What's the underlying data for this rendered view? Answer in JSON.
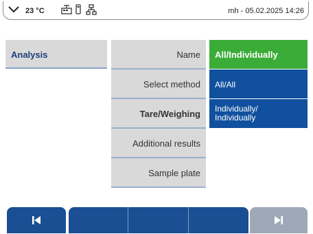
{
  "status": {
    "temperature": "23 °C",
    "user_datetime": "mh - 05.02.2025 14:26",
    "icons": [
      "chevron-down-icon",
      "balance-icon",
      "usb-icon",
      "network-icon"
    ]
  },
  "breadcrumb": {
    "analysis": "Analysis"
  },
  "menu": [
    {
      "label": "Name"
    },
    {
      "label": "Select method"
    },
    {
      "label": "Tare/Weighing"
    },
    {
      "label": "Additional results"
    },
    {
      "label": "Sample plate"
    }
  ],
  "options": {
    "selected": "All/Individually",
    "items": [
      "All/All",
      "Individually/",
      "Individually"
    ]
  },
  "colors": {
    "selected": "#3aac37",
    "option_bg": "#10509e",
    "menu_bg": "#d9d9d9",
    "nav": "#1a4f93"
  }
}
